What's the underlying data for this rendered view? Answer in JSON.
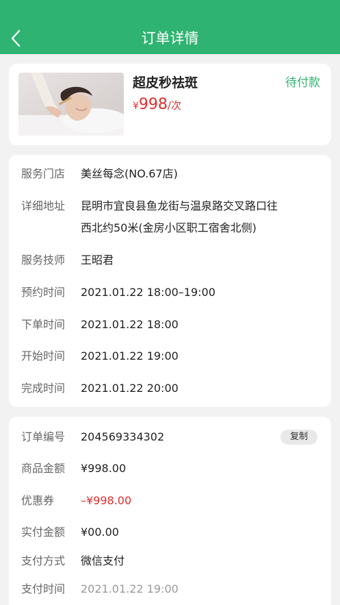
{
  "header": {
    "title": "订单详情"
  },
  "product": {
    "name": "超皮秒祛斑",
    "status": "待付款",
    "currency": "¥",
    "price": "998",
    "unit": "/次"
  },
  "info": {
    "rows": [
      {
        "label": "服务门店",
        "value": "美丝每念(NO.67店)"
      },
      {
        "label": "详细地址",
        "value_line1": "昆明市宜良县鱼龙街与温泉路交叉路口往",
        "value_line2": "西北约50米(金房小区职工宿舍北侧)"
      },
      {
        "label": "服务技师",
        "value": "王昭君"
      },
      {
        "label": "预约时间",
        "value": "2021.01.22 18:00–19:00"
      },
      {
        "label": "下单时间",
        "value": "2021.01.22 18:00"
      },
      {
        "label": "开始时间",
        "value": "2021.01.22 19:00"
      },
      {
        "label": "完成时间",
        "value": "2021.01.22 20:00"
      }
    ]
  },
  "order": {
    "copy_label": "复制",
    "rows": [
      {
        "label": "订单编号",
        "value": "204569334302"
      },
      {
        "label": "商品金额",
        "value": "¥998.00"
      },
      {
        "label": "优惠券",
        "value": "–¥998.00"
      },
      {
        "label": "实付金额",
        "value": "¥00.00"
      },
      {
        "label": "支付方式",
        "value": "微信支付"
      },
      {
        "label": "支付时间",
        "value": "2021.01.22 19:00"
      }
    ]
  },
  "colors": {
    "brand": "#2fb372",
    "price": "#e02e2e"
  }
}
